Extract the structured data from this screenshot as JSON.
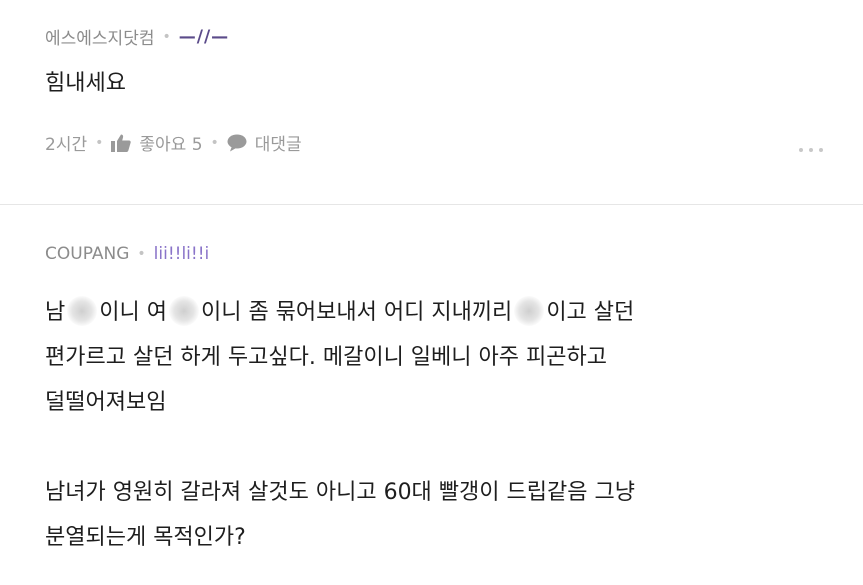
{
  "comments": [
    {
      "author": "에스에스지닷컴",
      "author_sub": "—//—",
      "body": "힘내세요",
      "time": "2시간",
      "like_label": "좋아요 5",
      "reply_label": "대댓글",
      "more_icon": "more-dots-icon"
    },
    {
      "author": "COUPANG",
      "author_sub": "lii!!li!!i",
      "body_line1_a": "남",
      "body_line1_b": "이니 여",
      "body_line1_c": "이니 좀 묶어보내서 어디 지내끼리",
      "body_line1_d": "이고 살던",
      "body_rest": "편가르고 살던 하게 두고싶다. 메갈이니 일베니 아주 피곤하고\n덜떨어져보임\n\n남녀가 영원히 갈라져 살것도 아니고 60대 빨갱이 드립같음 그냥\n분열되는게 목적인가?"
    }
  ],
  "colors": {
    "meta_text": "#9a9a9a",
    "author_sub": "#5b4b8a",
    "divider": "#e6e6e6"
  }
}
